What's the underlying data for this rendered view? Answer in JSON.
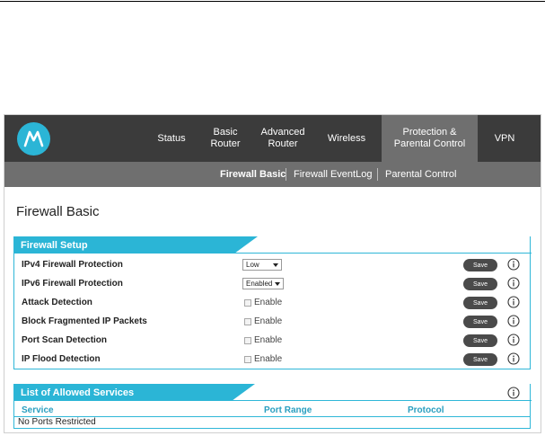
{
  "nav": {
    "logo_icon": "motorola-logo",
    "items": [
      {
        "label": "Status"
      },
      {
        "label": "Basic\nRouter"
      },
      {
        "label": "Advanced\nRouter"
      },
      {
        "label": "Wireless"
      },
      {
        "label": "Protection &\nParental Control"
      },
      {
        "label": "VPN"
      }
    ],
    "active_index": 4
  },
  "subnav": {
    "items": [
      {
        "label": "Firewall Basic"
      },
      {
        "label": "Firewall EventLog"
      },
      {
        "label": "Parental Control"
      }
    ],
    "active_index": 0
  },
  "page": {
    "title": "Firewall Basic"
  },
  "firewall_setup": {
    "title": "Firewall Setup",
    "save_label": "Save",
    "rows": [
      {
        "label": "IPv4 Firewall Protection",
        "type": "select",
        "value": "Low"
      },
      {
        "label": "IPv6 Firewall Protection",
        "type": "select",
        "value": "Enabled"
      },
      {
        "label": "Attack Detection",
        "type": "checkbox",
        "check_label": "Enable",
        "checked": false
      },
      {
        "label": "Block Fragmented IP Packets",
        "type": "checkbox",
        "check_label": "Enable",
        "checked": false
      },
      {
        "label": "Port Scan Detection",
        "type": "checkbox",
        "check_label": "Enable",
        "checked": false
      },
      {
        "label": "IP Flood Detection",
        "type": "checkbox",
        "check_label": "Enable",
        "checked": false
      }
    ]
  },
  "allowed_services": {
    "title": "List of Allowed Services",
    "columns": [
      "Service",
      "Port Range",
      "Protocol"
    ],
    "empty_text": "No Ports Restricted"
  },
  "colors": {
    "accent": "#2bb5d6",
    "nav_bg": "#3b3b3b",
    "nav_active": "#6f6f6f",
    "button": "#4a4a4a"
  }
}
